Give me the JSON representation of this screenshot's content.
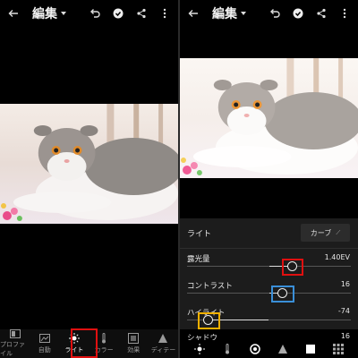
{
  "header": {
    "title": "編集"
  },
  "toolbar": {
    "items": [
      {
        "label": "プロファイル",
        "icon": "profile-icon"
      },
      {
        "label": "自動",
        "icon": "auto-icon"
      },
      {
        "label": "ライト",
        "icon": "sun-icon",
        "active": true
      },
      {
        "label": "カラー",
        "icon": "thermometer-icon"
      },
      {
        "label": "効果",
        "icon": "effects-icon"
      },
      {
        "label": "ディテー",
        "icon": "triangle-icon"
      }
    ]
  },
  "light_panel": {
    "title": "ライト",
    "curve_label": "カーブ",
    "sliders": [
      {
        "label": "露光量",
        "value": "1.40EV",
        "level": 0.64
      },
      {
        "label": "コントラスト",
        "value": "16",
        "level": 0.58
      },
      {
        "label": "ハイライト",
        "value": "-74",
        "level": 0.13
      },
      {
        "label": "シャドウ",
        "value": "16",
        "level": 0.58
      }
    ]
  },
  "colors": {
    "highlight_red": "#e01010",
    "highlight_blue": "#3a8fd8",
    "highlight_yellow": "#f0b000"
  }
}
